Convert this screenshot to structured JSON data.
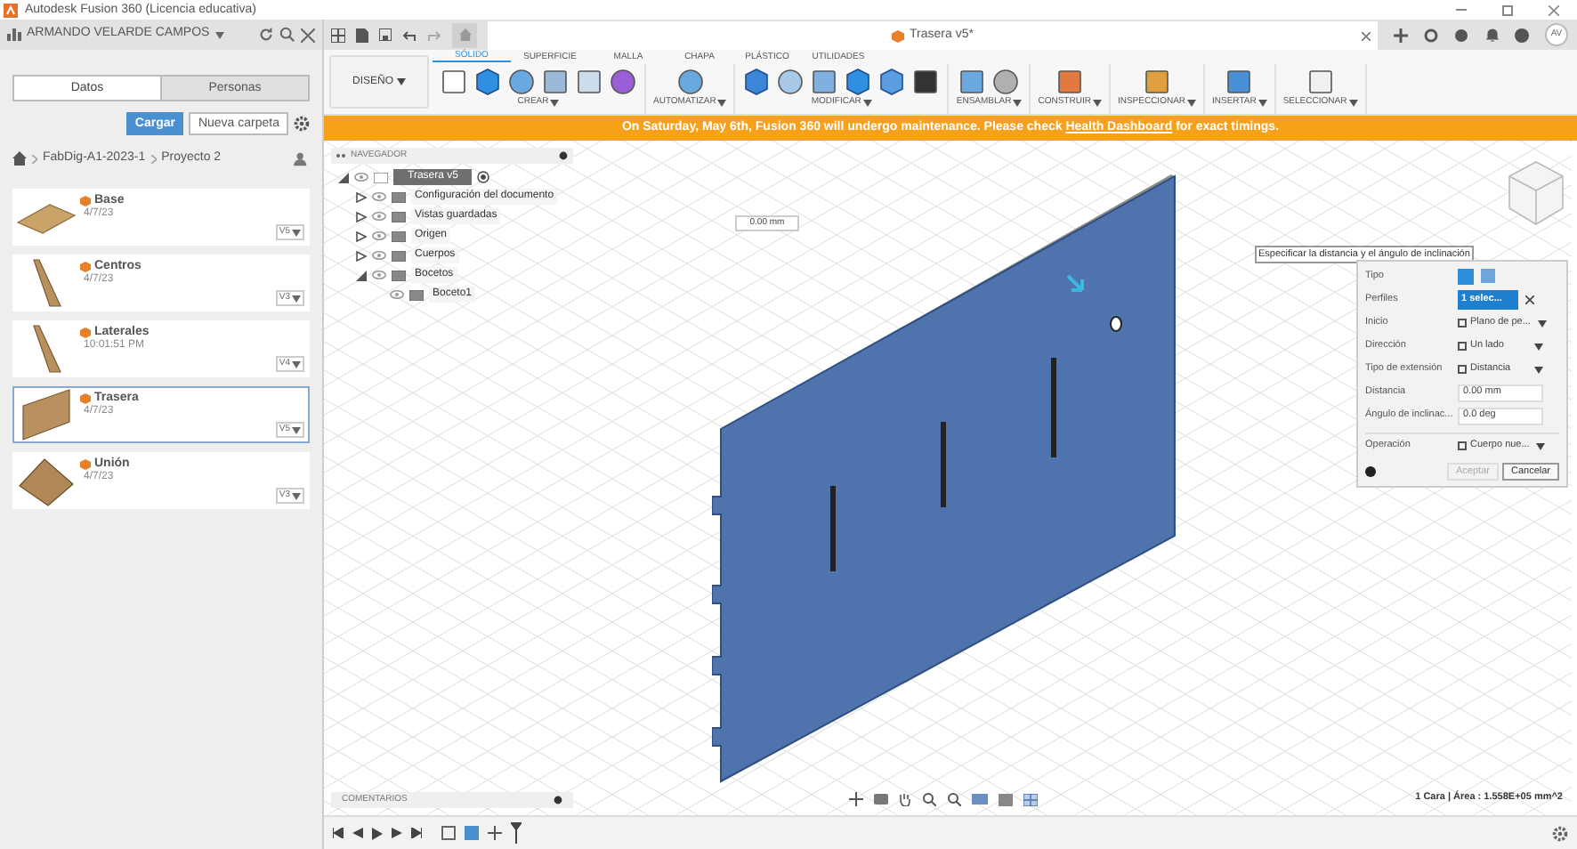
{
  "window": {
    "title": "Autodesk Fusion 360 (Licencia educativa)"
  },
  "data_panel": {
    "user": "ARMANDO VELARDE CAMPOS",
    "tabs": [
      {
        "label": "Datos",
        "selected": true
      },
      {
        "label": "Personas",
        "selected": false
      }
    ],
    "upload_button": "Cargar",
    "new_folder_button": "Nueva carpeta",
    "breadcrumb": [
      "FabDig-A1-2023-1",
      "Proyecto 2"
    ],
    "files": [
      {
        "name": "Base",
        "date": "4/7/23",
        "version": "V5",
        "selected": false,
        "kind": "plate"
      },
      {
        "name": "Centros",
        "date": "4/7/23",
        "version": "V3",
        "selected": false,
        "kind": "wedge"
      },
      {
        "name": "Laterales",
        "date": "10:01:51 PM",
        "version": "V4",
        "selected": false,
        "kind": "wedge"
      },
      {
        "name": "Trasera",
        "date": "4/7/23",
        "version": "V5",
        "selected": true,
        "kind": "panel"
      },
      {
        "name": "Unión",
        "date": "4/7/23",
        "version": "V3",
        "selected": false,
        "kind": "assembly"
      }
    ]
  },
  "document_tab": {
    "title": "Trasera v5*"
  },
  "toolbar": {
    "workspace": "DISEÑO",
    "tabs": [
      {
        "label": "SÓLIDO",
        "selected": true
      },
      {
        "label": "SUPERFICIE",
        "selected": false
      },
      {
        "label": "MALLA",
        "selected": false
      },
      {
        "label": "CHAPA",
        "selected": false
      },
      {
        "label": "PLÁSTICO",
        "selected": false
      },
      {
        "label": "UTILIDADES",
        "selected": false
      }
    ],
    "groups": [
      "CREAR",
      "AUTOMATIZAR",
      "MODIFICAR",
      "ENSAMBLAR",
      "CONSTRUIR",
      "INSPECCIONAR",
      "INSERTAR",
      "SELECCIONAR"
    ]
  },
  "profile": {
    "initials": "AV"
  },
  "banner": {
    "before": "On Saturday, May 6th, Fusion 360 will undergo maintenance. Please check",
    "link": "Health Dashboard",
    "after": "for exact timings."
  },
  "navigator": {
    "title": "NAVEGADOR",
    "tree": [
      {
        "label": "Trasera v5",
        "selected": true,
        "expanded": true,
        "children": [
          {
            "label": "Configuración del documento",
            "selected": false,
            "expanded": false
          },
          {
            "label": "Vistas guardadas",
            "selected": false,
            "expanded": false
          },
          {
            "label": "Origen",
            "selected": false,
            "expanded": false
          },
          {
            "label": "Cuerpos",
            "selected": false,
            "expanded": false
          },
          {
            "label": "Bocetos",
            "selected": false,
            "expanded": true,
            "children": [
              {
                "label": "Boceto1",
                "selected": false
              }
            ]
          }
        ]
      }
    ]
  },
  "dimension_field": {
    "value": "0.00 mm"
  },
  "extrude_dialog": {
    "tooltip": "Especificar la distancia y el ángulo de inclinación",
    "rows": [
      {
        "kind": "type",
        "label": "Tipo"
      },
      {
        "kind": "selection",
        "label": "Perfiles",
        "value": "1 selec..."
      },
      {
        "kind": "dropdown",
        "label": "Inicio",
        "value": "Plano de pe..."
      },
      {
        "kind": "dropdown",
        "label": "Dirección",
        "value": "Un lado"
      },
      {
        "kind": "dropdown",
        "label": "Tipo de extensión",
        "value": "Distancia"
      },
      {
        "kind": "input",
        "label": "Distancia",
        "value": "0.00 mm"
      },
      {
        "kind": "input",
        "label": "Ángulo de inclinac...",
        "value": "0.0 deg"
      },
      {
        "kind": "dropdown",
        "label": "Operación",
        "value": "Cuerpo nue..."
      }
    ],
    "ok_button": {
      "label": "Aceptar",
      "disabled": true
    },
    "cancel_button": "Cancelar"
  },
  "comments": {
    "title": "COMENTARIOS"
  },
  "status": {
    "text": "1 Cara | Área : 1.558E+05 mm^2"
  }
}
